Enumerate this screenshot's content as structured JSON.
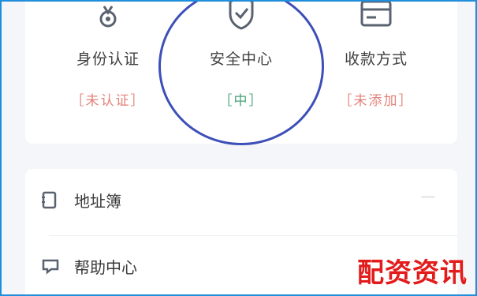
{
  "top_entries": [
    {
      "label": "身份认证",
      "status": "［未认证］",
      "status_color": "#e3837a",
      "icon": "badge-icon"
    },
    {
      "label": "安全中心",
      "status": "［中］",
      "status_color": "#4aa37a",
      "icon": "shield-check-icon"
    },
    {
      "label": "收款方式",
      "status": "［未添加］",
      "status_color": "#e3837a",
      "icon": "card-icon"
    }
  ],
  "list_items": [
    {
      "label": "地址簿",
      "icon": "address-book-icon"
    },
    {
      "label": "帮助中心",
      "icon": "help-icon"
    }
  ],
  "watermark": "配资资讯",
  "colors": {
    "frame_border": "#1f8fdc",
    "highlight_ring": "#3d4fb8",
    "background": "#f4f6fa",
    "watermark": "#e21b1b"
  }
}
